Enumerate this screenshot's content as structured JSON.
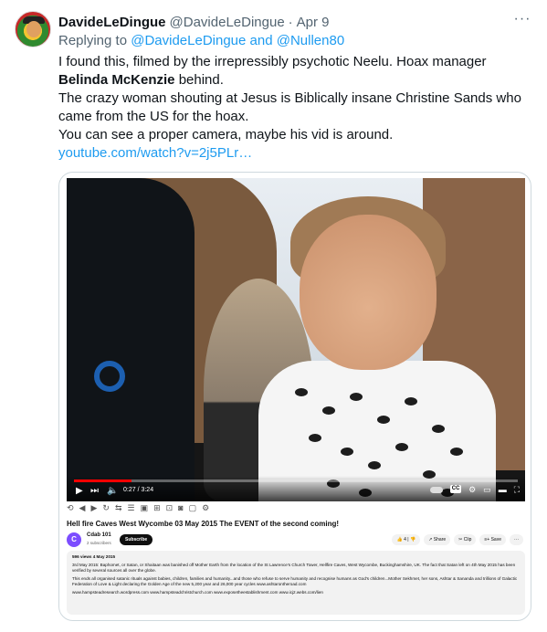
{
  "tweet": {
    "author_name": "DavideLeDingue",
    "author_handle": "@DavideLeDingue",
    "separator": "·",
    "date": "Apr 9",
    "more_icon": "more-horizontal-icon",
    "reply_prefix": "Replying to",
    "reply_handle_1": "@DavideLeDingue",
    "reply_and": "and",
    "reply_handle_2": "@Nullen80",
    "line1": "I found this, filmed by the irrepressibly psychotic Neelu. Hoax manager",
    "line2_bold": "Belinda McKenzie",
    "line2_rest": " behind.",
    "line3": "The crazy woman shouting at Jesus is Biblically insane Christine Sands who came from the US for the hoax.",
    "line4": "You can see a proper camera, maybe his vid is around.",
    "link": "youtube.com/watch?v=2j5PLr…",
    "accent": "#1d9bf0"
  },
  "video": {
    "time": "0:27 / 3:24",
    "progress": 0.13,
    "progress_color": "#ff0000",
    "cc_label": "CC"
  },
  "youtube": {
    "title": "Hell fire Caves West Wycombe 03 May 2015 The EVENT of the second coming!",
    "channel_initial": "C",
    "channel_name": "Cdab 101",
    "channel_subs": "2 subscribers",
    "subscribe": "Subscribe",
    "likes": "4",
    "share": "Share",
    "clip": "Clip",
    "save": "Save",
    "more": "···",
    "desc_meta": "596 views  4 May 2015",
    "desc_p1": "3rd May 2015:  Baphomet, or Satan, or Shaitaan was banished off Mother Earth from the location of the St Lawrence's Church Tower, Hellfire Caves, West Wycombe, Buckinghamshire, UK.  The fact that Satan left on 4th May 2015 has been verified by several sources all over the globe.",
    "desc_p2": "This ends all organised satanic rituals against babies, children, families and humanity...and those who refuse to serve humanity and recognise humans as God's children...Mother Sekhmet, her sons, Ashtar & Sananda and trillions of Galactic Federation of Love & Light declaring the Golden Age of the new 5,200 year and 26,000 year cycles www.ashtarontheroad.com",
    "desc_p3": "www.hampsteadresearch.wordpress.com  www.hampsteadchristchurch.com  www.exposetheestablishment.com  www.icj2.webs.com/lien"
  }
}
